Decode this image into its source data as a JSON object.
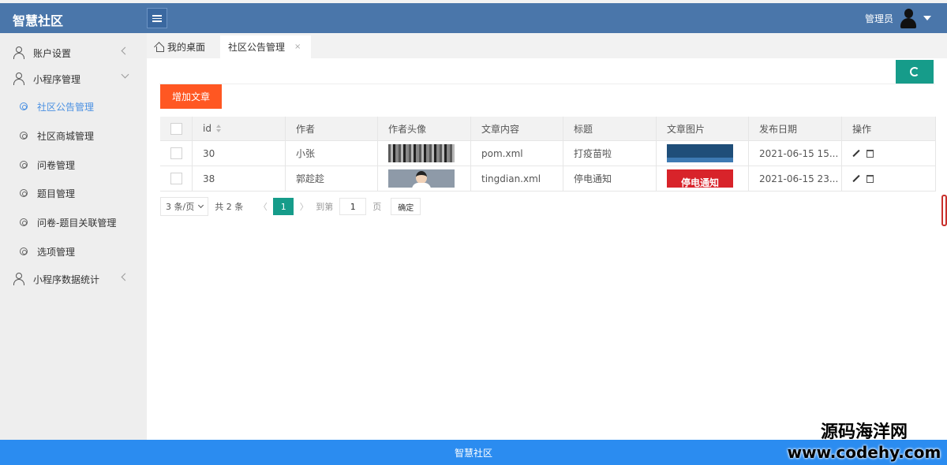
{
  "header": {
    "app_title": "智慧社区",
    "user_name": "管理员"
  },
  "sidebar": {
    "menus": [
      {
        "label": "账户设置"
      },
      {
        "label": "小程序管理"
      },
      {
        "label": "小程序数据统计"
      }
    ],
    "sub_items": [
      {
        "label": "社区公告管理",
        "active": true
      },
      {
        "label": "社区商城管理"
      },
      {
        "label": "问卷管理"
      },
      {
        "label": "题目管理"
      },
      {
        "label": "问卷-题目关联管理"
      },
      {
        "label": "选项管理"
      }
    ]
  },
  "tabs": {
    "home_label": "我的桌面",
    "active_label": "社区公告管理",
    "close_glyph": "×"
  },
  "toolbar": {
    "add_label": "增加文章"
  },
  "table": {
    "columns": [
      "id",
      "作者",
      "作者头像",
      "文章内容",
      "标题",
      "文章图片",
      "发布日期",
      "操作"
    ],
    "rows": [
      {
        "id": "30",
        "author": "小张",
        "content": "pom.xml",
        "title": "打疫苗啦",
        "date": "2021-06-15 15..."
      },
      {
        "id": "38",
        "author": "郭趁趁",
        "content": "tingdian.xml",
        "title": "停电通知",
        "image_text": "停电通知",
        "date": "2021-06-15 23..."
      }
    ]
  },
  "pager": {
    "page_size": "3 条/页",
    "total": "共 2 条",
    "prev": "〈",
    "current_page": "1",
    "next": "〉",
    "goto_label": "到第",
    "goto_value": "1",
    "goto_unit": "页",
    "confirm_label": "确定"
  },
  "footer": {
    "text": "智慧社区"
  },
  "watermark": {
    "line1": "源码海洋网",
    "line2": "www.codehy.com"
  },
  "colors": {
    "header": "#4a76aa",
    "accent_teal": "#169c8a",
    "add_button": "#ff5722",
    "footer": "#2b8cf0"
  }
}
